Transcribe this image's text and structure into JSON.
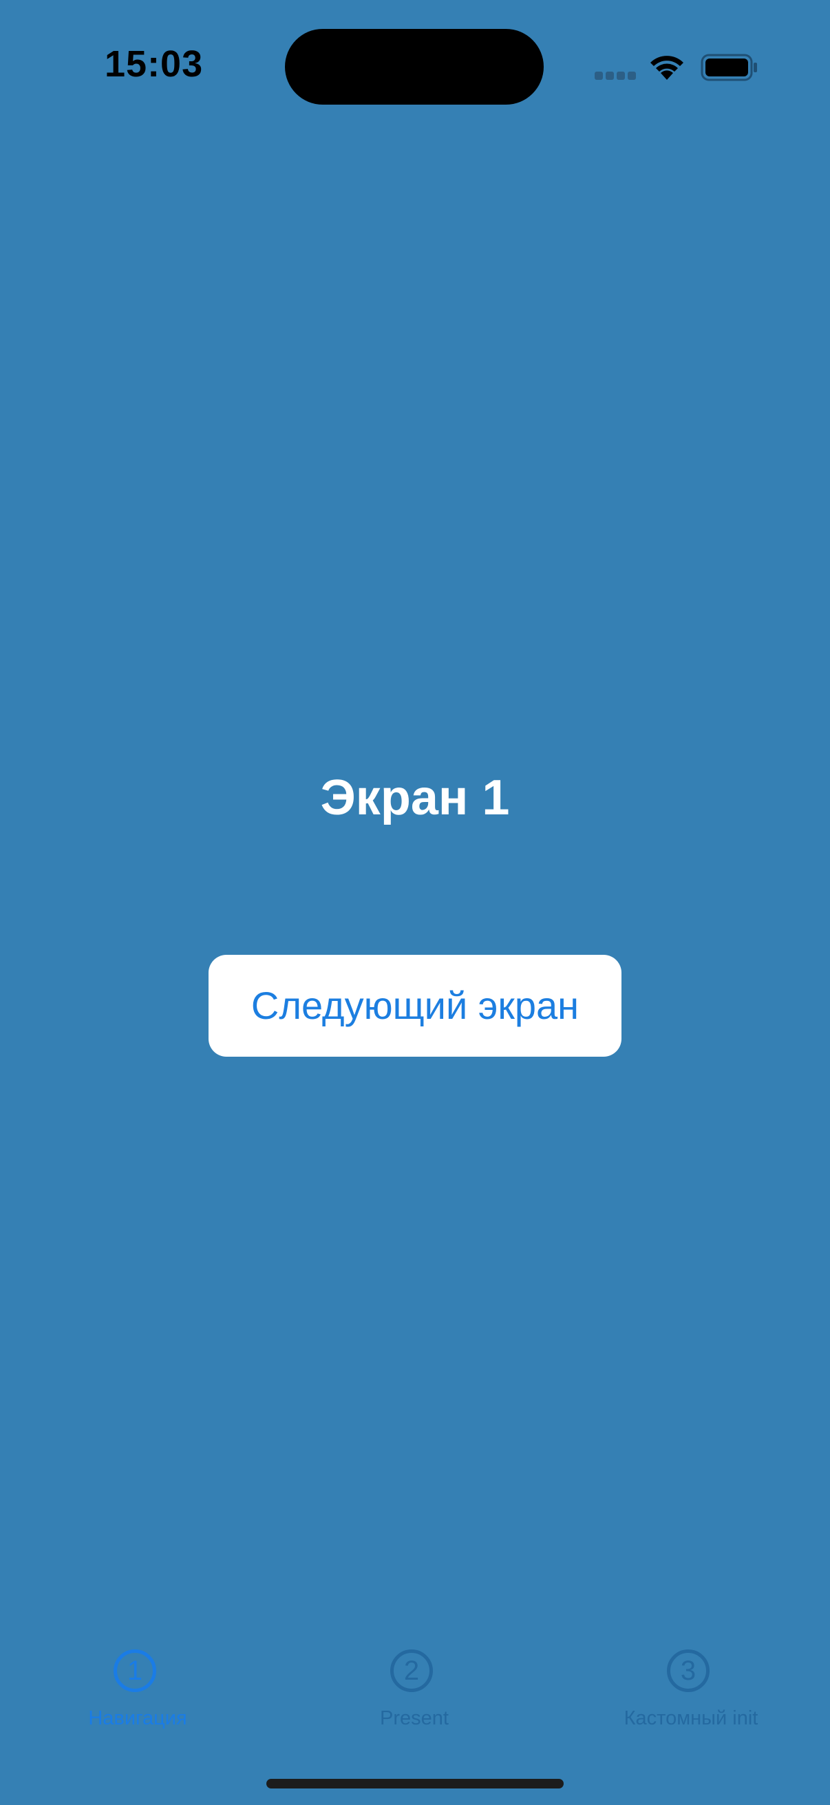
{
  "status_bar": {
    "time": "15:03",
    "icons": [
      "cellular-signal-icon",
      "wifi-icon",
      "battery-icon"
    ]
  },
  "screen": {
    "title": "Экран 1",
    "next_button_label": "Следующий экран"
  },
  "tab_bar": {
    "active_index": 0,
    "tabs": [
      {
        "icon_number": "1",
        "label": "Навигация"
      },
      {
        "icon_number": "2",
        "label": "Present"
      },
      {
        "icon_number": "3",
        "label": "Кастомный init"
      }
    ]
  },
  "colors": {
    "background": "#3580b4",
    "accent": "#1a7ce6",
    "button_background": "#ffffff",
    "inactive_tab": "#2469a0"
  }
}
